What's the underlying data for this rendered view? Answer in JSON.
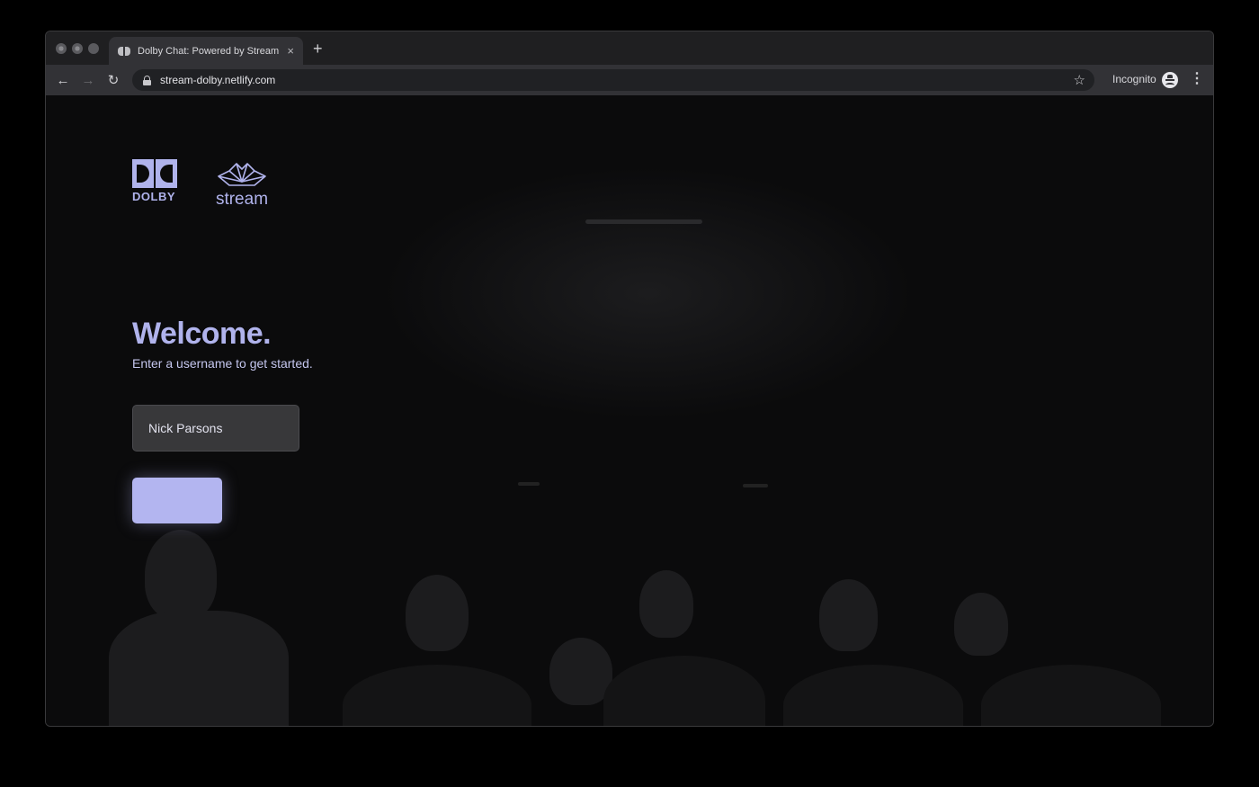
{
  "browser": {
    "tab_title": "Dolby Chat: Powered by Stream",
    "tab_close": "×",
    "new_tab": "+",
    "url": "stream-dolby.netlify.com",
    "incognito_label": "Incognito",
    "icons": {
      "back": "arrow-left-icon",
      "forward": "arrow-right-icon",
      "reload": "reload-icon",
      "lock": "lock-icon",
      "star": "star-icon",
      "menu": "more-vert-icon",
      "incognito": "incognito-icon"
    }
  },
  "page": {
    "logos": {
      "dolby_text": "DOLBY",
      "stream_text": "stream"
    },
    "heading": "Welcome.",
    "subtitle": "Enter a username to get started.",
    "username_value": "Nick Parsons",
    "submit_label": "",
    "accent_color": "#b0b3ec"
  }
}
